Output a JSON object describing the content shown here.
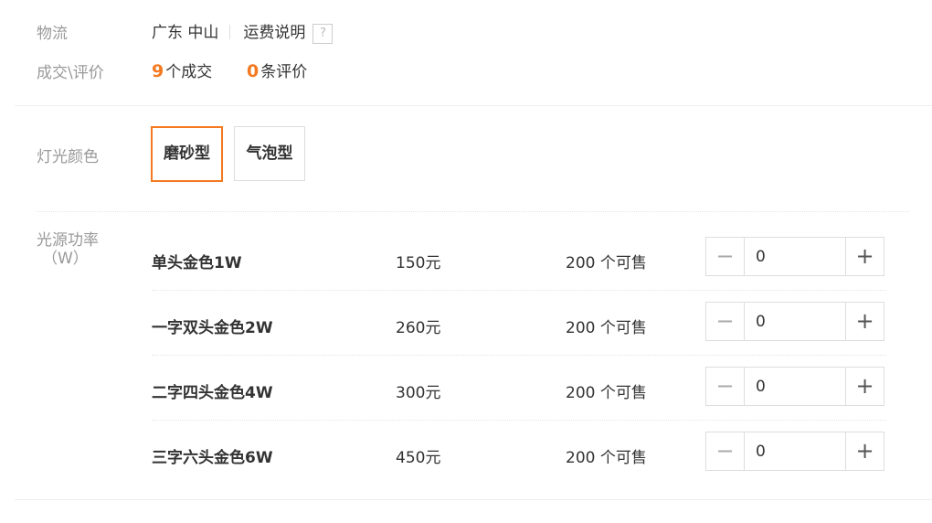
{
  "logistics": {
    "label": "物流",
    "location": "广东 中山",
    "shipping_link": "运费说明",
    "help_icon": "?"
  },
  "deals": {
    "label": "成交\\评价",
    "sales_count": "9",
    "sales_text": "个成交",
    "review_count": "0",
    "review_text": "条评价"
  },
  "light_color": {
    "label": "灯光颜色",
    "options": [
      {
        "label": "磨砂型",
        "selected": true
      },
      {
        "label": "气泡型",
        "selected": false
      }
    ]
  },
  "power": {
    "label_line1": "光源功率",
    "label_line2": "（W）",
    "items": [
      {
        "name": "单头金色1W",
        "price": "150元",
        "stock": "200 个可售",
        "quantity": "0"
      },
      {
        "name": "一字双头金色2W",
        "price": "260元",
        "stock": "200 个可售",
        "quantity": "0"
      },
      {
        "name": "二字四头金色4W",
        "price": "300元",
        "stock": "200 个可售",
        "quantity": "0"
      },
      {
        "name": "三字六头金色6W",
        "price": "450元",
        "stock": "200 个可售",
        "quantity": "0"
      }
    ],
    "minus_symbol": "−",
    "plus_symbol": "+"
  },
  "colors": {
    "accent": "#f47920",
    "label_gray": "#999999",
    "text": "#333333",
    "border": "#dddddd"
  }
}
